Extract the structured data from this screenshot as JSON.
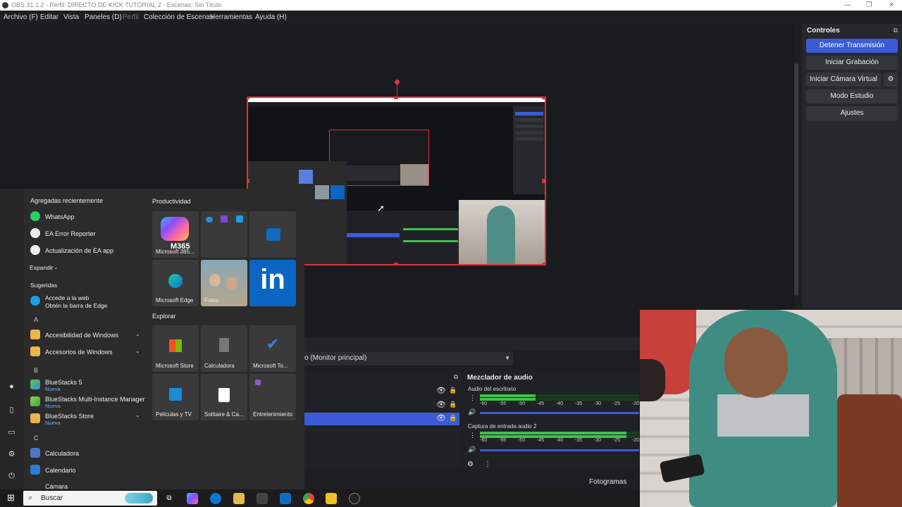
{
  "window": {
    "title": "OBS 31.1.2 - Perfil: DIRECTO DE KICK TUTORIAL 2 - Escenas: Sin Título"
  },
  "menu": [
    "Archivo (F)",
    "Editar",
    "Vista",
    "Paneles (D)",
    "Perfil",
    "Colección de Escenas",
    "Herramientas",
    "Ayuda (H)"
  ],
  "controls": {
    "title": "Controles",
    "stop_stream": "Detener Transmisión",
    "start_recording": "Iniciar Grabación",
    "start_virtual_cam": "Iniciar Cámara Virtual",
    "studio_mode": "Modo Estudio",
    "settings": "Ajustes"
  },
  "monitor": {
    "label": "o (Monitor principal)"
  },
  "mixer": {
    "title": "Mezclador de audio",
    "channels": [
      {
        "name": "Audio del escritorio",
        "level": 0.35
      },
      {
        "name": "Captura de entrada audio 2",
        "level": 0.92
      }
    ],
    "scale": [
      "-60",
      "-55",
      "-50",
      "-45",
      "-40",
      "-35",
      "-30",
      "-25",
      "-20"
    ]
  },
  "status": {
    "frames": "Fotogramas Perdi"
  },
  "start_menu": {
    "recent_title": "Agregadas recientemente",
    "recent": [
      "WhatsApp",
      "EA Error Reporter",
      "Actualización de EA app"
    ],
    "expand": "Expandir",
    "suggested_title": "Sugeridas",
    "suggested_line1": "Accede a la web",
    "suggested_line2": "Obtén la barra de Edge",
    "letter_a": "A",
    "apps_a": [
      "Accesibilidad de Windows",
      "Accesorios de Windows"
    ],
    "letter_b": "B",
    "apps_b": [
      "BlueStacks 5",
      "BlueStacks Multi-Instance Manager",
      "BlueStacks Store"
    ],
    "new_badge": "Nueva",
    "letter_c": "C",
    "apps_c": [
      "Calculadora",
      "Calendario",
      "Cámara"
    ],
    "productivity_title": "Productividad",
    "explore_title": "Explorar",
    "tiles": [
      "Microsoft 365...",
      "Microsoft Edge",
      "Fotos",
      "Microsoft Store",
      "Calculadora",
      "Microsoft To...",
      "Películas y TV",
      "Solitaire & Ca...",
      "Entretenimiento"
    ],
    "m365_badge": "M365"
  },
  "taskbar": {
    "search_placeholder": "Buscar"
  },
  "colors": {
    "accent": "#3b5cd6",
    "selection": "#e0303a",
    "meter": "#3ec14b"
  }
}
